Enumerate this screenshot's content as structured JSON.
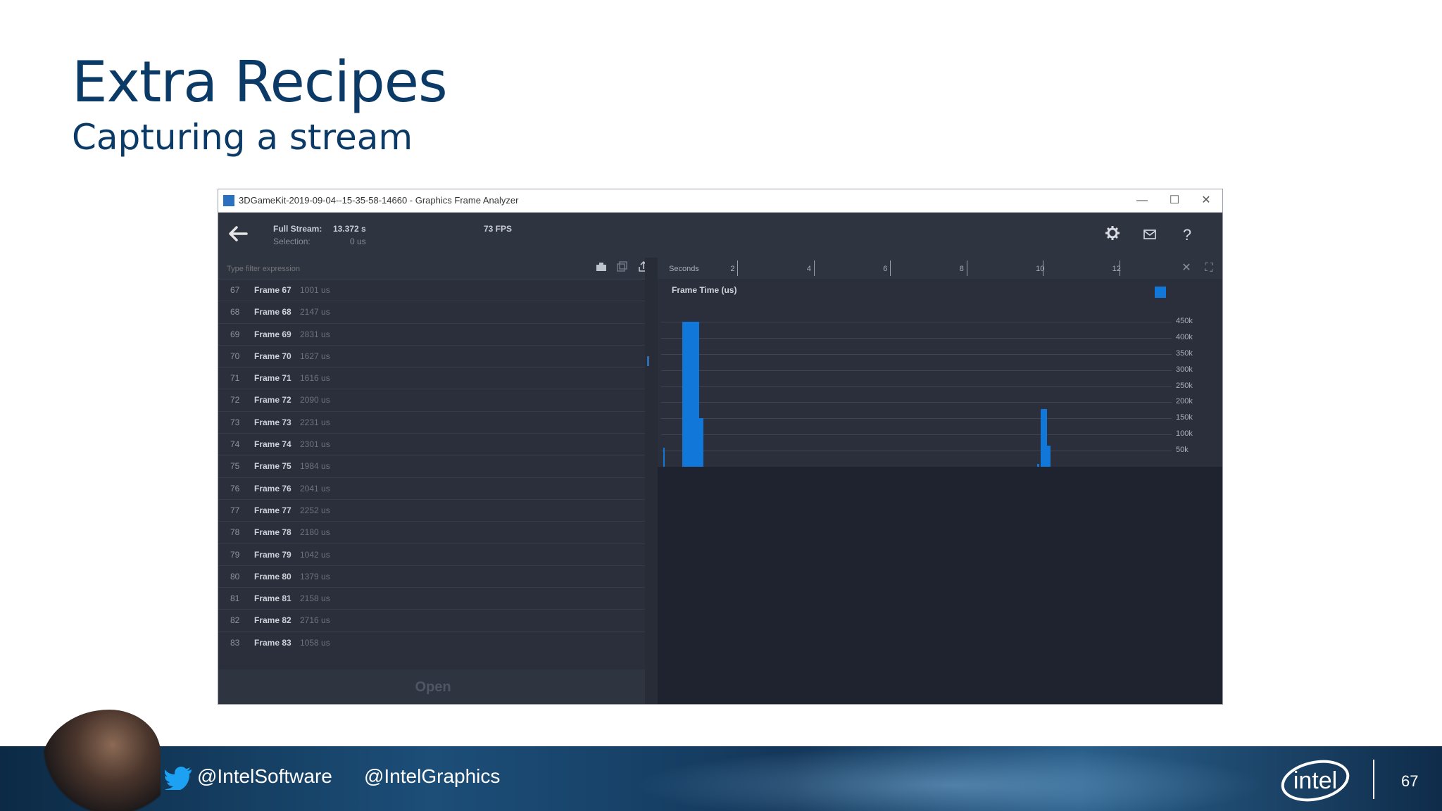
{
  "slide": {
    "title": "Extra Recipes",
    "subtitle": "Capturing a stream"
  },
  "window": {
    "title": "3DGameKit-2019-09-04--15-35-58-14660 - Graphics Frame Analyzer",
    "minimize": "—",
    "maximize": "☐",
    "close": "✕"
  },
  "toolbar": {
    "full_stream_label": "Full Stream:",
    "full_stream_value": "13.372 s",
    "selection_label": "Selection:",
    "selection_value": "0 us",
    "fps": "73 FPS",
    "back_icon": "arrow-left-icon",
    "settings_icon": "gear-icon",
    "message_icon": "envelope-icon",
    "help_icon": "question-icon",
    "help_label": "?"
  },
  "filter": {
    "placeholder": "Type filter expression"
  },
  "frames": [
    {
      "idx": "67",
      "name": "Frame 67",
      "time": "1001 us"
    },
    {
      "idx": "68",
      "name": "Frame 68",
      "time": "2147 us"
    },
    {
      "idx": "69",
      "name": "Frame 69",
      "time": "2831 us"
    },
    {
      "idx": "70",
      "name": "Frame 70",
      "time": "1627 us"
    },
    {
      "idx": "71",
      "name": "Frame 71",
      "time": "1616 us"
    },
    {
      "idx": "72",
      "name": "Frame 72",
      "time": "2090 us"
    },
    {
      "idx": "73",
      "name": "Frame 73",
      "time": "2231 us"
    },
    {
      "idx": "74",
      "name": "Frame 74",
      "time": "2301 us"
    },
    {
      "idx": "75",
      "name": "Frame 75",
      "time": "1984 us"
    },
    {
      "idx": "76",
      "name": "Frame 76",
      "time": "2041 us"
    },
    {
      "idx": "77",
      "name": "Frame 77",
      "time": "2252 us"
    },
    {
      "idx": "78",
      "name": "Frame 78",
      "time": "2180 us"
    },
    {
      "idx": "79",
      "name": "Frame 79",
      "time": "1042 us"
    },
    {
      "idx": "80",
      "name": "Frame 80",
      "time": "1379 us"
    },
    {
      "idx": "81",
      "name": "Frame 81",
      "time": "2158 us"
    },
    {
      "idx": "82",
      "name": "Frame 82",
      "time": "2716 us"
    },
    {
      "idx": "83",
      "name": "Frame 83",
      "time": "1058 us"
    }
  ],
  "open_button": "Open",
  "timeline": {
    "label": "Seconds",
    "ticks": [
      "2",
      "4",
      "6",
      "8",
      "10",
      "12"
    ]
  },
  "chart_data": {
    "type": "bar",
    "title": "Frame Time (us)",
    "xlabel": "Seconds",
    "ylabel": "",
    "xlim": [
      0,
      13.372
    ],
    "ylim": [
      0,
      500000
    ],
    "yticks": [
      "450k",
      "400k",
      "350k",
      "300k",
      "250k",
      "200k",
      "150k",
      "100k",
      "50k"
    ],
    "ytick_values": [
      450000,
      400000,
      350000,
      300000,
      250000,
      200000,
      150000,
      100000,
      50000
    ],
    "bars": [
      {
        "x": 0.05,
        "width": 0.05,
        "value": 60000
      },
      {
        "x": 0.55,
        "width": 0.45,
        "value": 450000
      },
      {
        "x": 0.9,
        "width": 0.2,
        "value": 150000
      },
      {
        "x": 9.85,
        "width": 0.05,
        "value": 8000
      },
      {
        "x": 9.95,
        "width": 0.15,
        "value": 180000
      },
      {
        "x": 10.1,
        "width": 0.1,
        "value": 65000
      }
    ],
    "color": "#1177d9",
    "grid": true
  },
  "footer": {
    "twitter_icon": "twitter-bird-icon",
    "handle1": "@IntelSoftware",
    "handle2": "@IntelGraphics",
    "logo": "intel",
    "page_number": "67"
  }
}
